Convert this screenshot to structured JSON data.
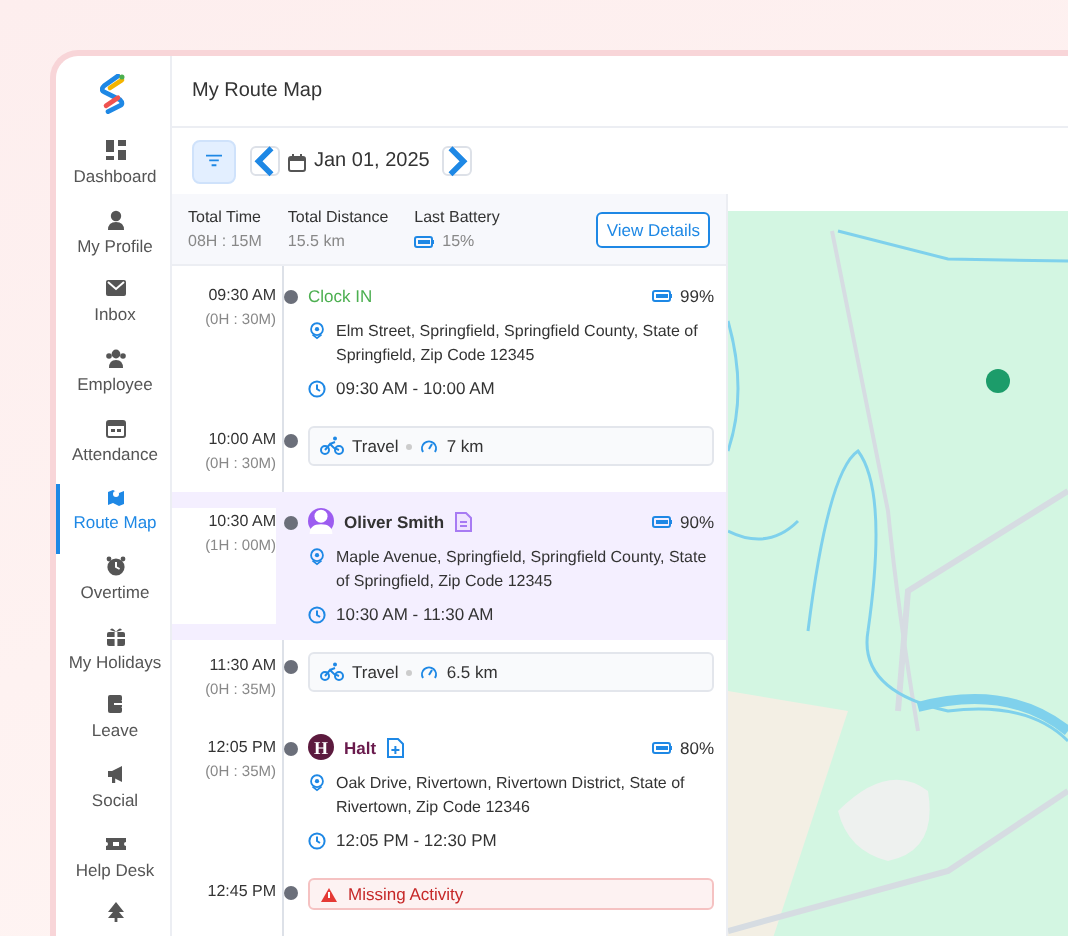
{
  "sidebar": {
    "items": [
      {
        "label": "Dashboard",
        "selected": false
      },
      {
        "label": "My Profile",
        "selected": false
      },
      {
        "label": "Inbox",
        "selected": false
      },
      {
        "label": "Employee",
        "selected": false
      },
      {
        "label": "Attendance",
        "selected": false
      },
      {
        "label": "Route Map",
        "selected": true
      },
      {
        "label": "Overtime",
        "selected": false
      },
      {
        "label": "My Holidays",
        "selected": false
      },
      {
        "label": "Leave",
        "selected": false
      },
      {
        "label": "Social",
        "selected": false
      },
      {
        "label": "Help Desk",
        "selected": false
      },
      {
        "selected": false
      }
    ]
  },
  "page_title": "My Route Map",
  "toolbar": {
    "date": "Jan 01, 2025"
  },
  "summary": {
    "stats": [
      {
        "label": "Total Time",
        "value": "08H : 15M",
        "kind": "text"
      },
      {
        "label": "Total Distance",
        "value": "15.5 km",
        "kind": "text"
      },
      {
        "label": "Last Battery",
        "value": "15%",
        "kind": "battery"
      }
    ],
    "button": "View Details"
  },
  "timeline": [
    {
      "kind": "clock",
      "time": "09:30 AM",
      "duration": "(0H : 30M)",
      "title": "Clock IN",
      "battery": "99%",
      "address": "Elm Street, Springfield, Springfield County, State of Springfield, Zip Code 12345",
      "range": "09:30 AM -  10:00 AM",
      "selected": false
    },
    {
      "kind": "travel",
      "time": "10:00 AM",
      "duration": "(0H : 30M)",
      "title": "Travel",
      "distance": "7 km",
      "selected": false
    },
    {
      "kind": "visit",
      "time": "10:30 AM",
      "duration": "(1H : 00M)",
      "title": "Oliver Smith",
      "battery": "90%",
      "address": "Maple Avenue, Springfield, Springfield County, State of Springfield, Zip Code 12345",
      "range": "10:30 AM -  11:30 AM",
      "selected": true
    },
    {
      "kind": "travel",
      "time": "11:30 AM",
      "duration": "(0H : 35M)",
      "title": "Travel",
      "distance": "6.5 km",
      "selected": false
    },
    {
      "kind": "visit",
      "letter": "H",
      "time": "12:05 PM",
      "duration": "(0H : 35M)",
      "title": "Halt",
      "battery": "80%",
      "address": "Oak Drive, Rivertown, Rivertown District, State of Rivertown, Zip Code 12346",
      "range": "12:05 PM -  12:30 PM",
      "selected": false
    },
    {
      "kind": "missing",
      "time": "12:45 PM",
      "title": "Missing Activity",
      "selected": false
    }
  ]
}
